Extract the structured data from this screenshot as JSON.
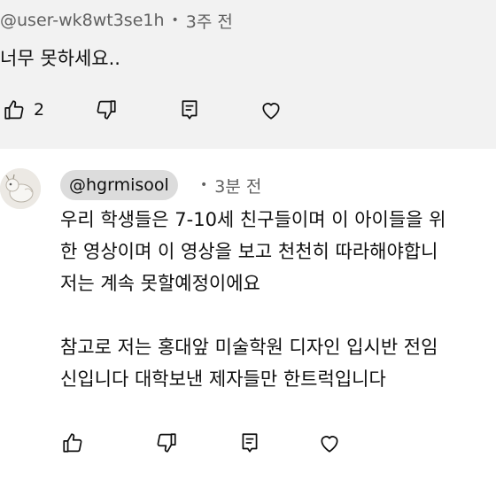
{
  "comment1": {
    "handle": "@user-wk8wt3se1h",
    "separator": "•",
    "time": "3주 전",
    "text": "너무 못하세요..",
    "like_count": "2"
  },
  "reply": {
    "handle": "@hgrmisool",
    "separator": "•",
    "time": "3분 전",
    "lines": [
      "우리 학생들은 7-10세 친구들이며 이 아이들을 위",
      "한 영상이며 이 영상을 보고 천천히 따라해야합니",
      "저는 계속 못할예정이에요",
      "",
      "참고로 저는 홍대앞 미술학원 디자인 입시반 전임",
      "신입니다 대학보낸 제자들만 한트럭입니다"
    ]
  },
  "icons": {
    "like": "thumbs-up-icon",
    "dislike": "thumbs-down-icon",
    "reply": "reply-comment-icon",
    "heart": "heart-icon"
  },
  "colors": {
    "top_background": "#f2f2f2",
    "chip_background": "#dcdcdc",
    "meta_text": "#606060"
  }
}
